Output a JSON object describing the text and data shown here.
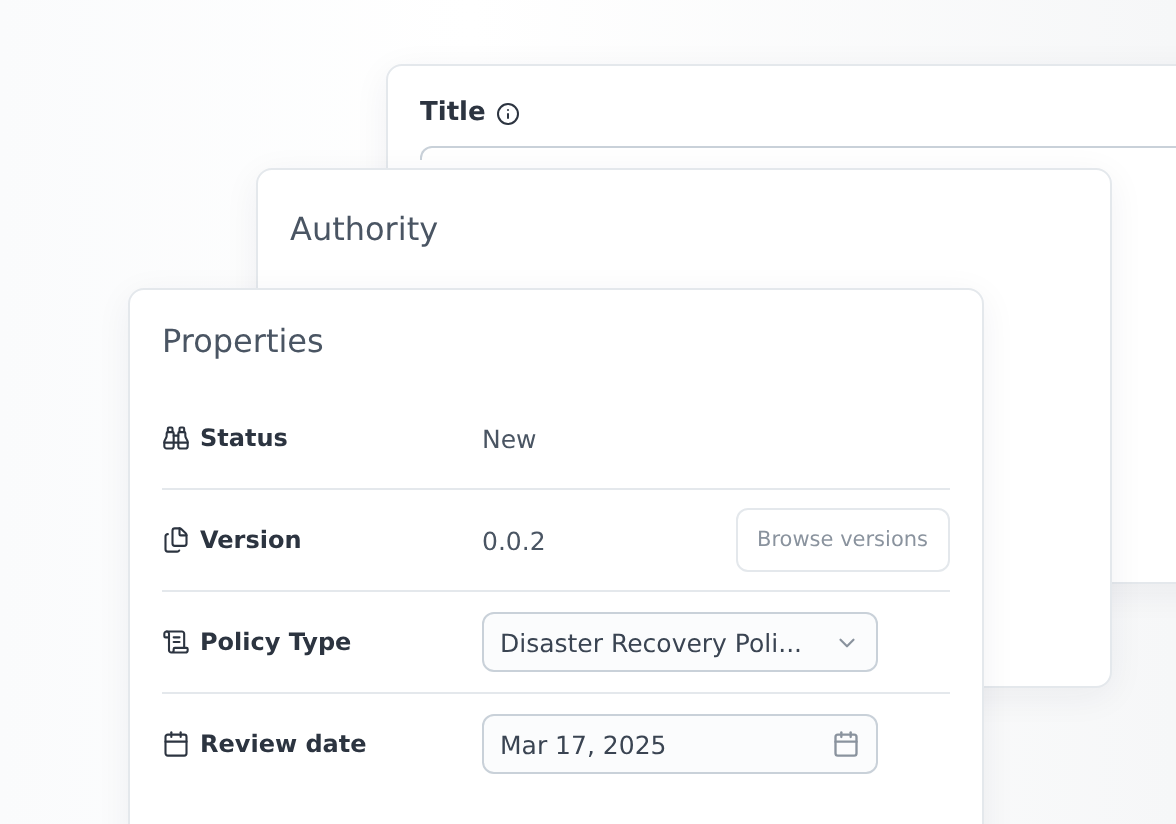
{
  "back_card": {
    "title": "Title"
  },
  "middle_card": {
    "title": "Authority"
  },
  "properties": {
    "title": "Properties",
    "rows": [
      {
        "kind": "text",
        "label": "Status",
        "value": "New"
      },
      {
        "kind": "button",
        "label": "Version",
        "value": "0.0.2",
        "button": "Browse versions"
      },
      {
        "kind": "select",
        "label": "Policy Type",
        "value": "Disaster Recovery Poli..."
      },
      {
        "kind": "date",
        "label": "Review date",
        "value": "Mar 17, 2025"
      }
    ]
  }
}
